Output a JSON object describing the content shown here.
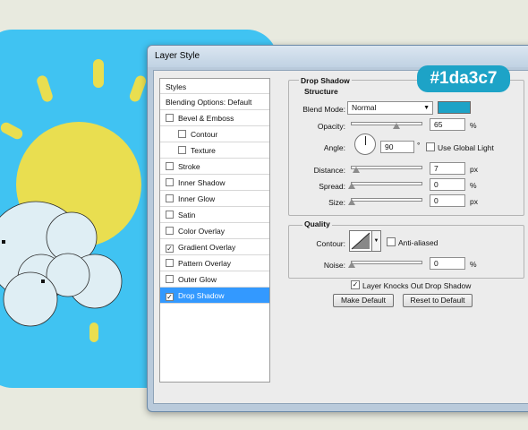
{
  "window": {
    "title": "Layer Style"
  },
  "badge": {
    "text": "#1da3c7",
    "color": "#1da3c7"
  },
  "styles_panel": {
    "header": "Styles",
    "blending": "Blending Options: Default",
    "items": [
      {
        "label": "Bevel & Emboss",
        "checked": false
      },
      {
        "label": "Contour",
        "checked": false,
        "indent": true
      },
      {
        "label": "Texture",
        "checked": false,
        "indent": true
      },
      {
        "label": "Stroke",
        "checked": false
      },
      {
        "label": "Inner Shadow",
        "checked": false
      },
      {
        "label": "Inner Glow",
        "checked": false
      },
      {
        "label": "Satin",
        "checked": false
      },
      {
        "label": "Color Overlay",
        "checked": false
      },
      {
        "label": "Gradient Overlay",
        "checked": true
      },
      {
        "label": "Pattern Overlay",
        "checked": false
      },
      {
        "label": "Outer Glow",
        "checked": false
      },
      {
        "label": "Drop Shadow",
        "checked": true,
        "selected": true
      }
    ]
  },
  "drop_shadow": {
    "title": "Drop Shadow",
    "structure_title": "Structure",
    "blend_mode_label": "Blend Mode:",
    "blend_mode_value": "Normal",
    "shadow_color": "#1da3c7",
    "opacity_label": "Opacity:",
    "opacity_value": "65",
    "percent": "%",
    "px": "px",
    "angle_label": "Angle:",
    "angle_value": "90",
    "degree": "°",
    "global_light_label": "Use Global Light",
    "distance_label": "Distance:",
    "distance_value": "7",
    "spread_label": "Spread:",
    "spread_value": "0",
    "size_label": "Size:",
    "size_value": "0",
    "quality_title": "Quality",
    "contour_label": "Contour:",
    "anti_aliased_label": "Anti-aliased",
    "noise_label": "Noise:",
    "noise_value": "0",
    "knockout_label": "Layer Knocks Out Drop Shadow",
    "knockout_checked": "✓",
    "make_default": "Make Default",
    "reset_default": "Reset to Default"
  },
  "colors": {
    "artwork_bg": "#40c3f2",
    "sun": "#e9de50",
    "selection": "#3399ff"
  }
}
